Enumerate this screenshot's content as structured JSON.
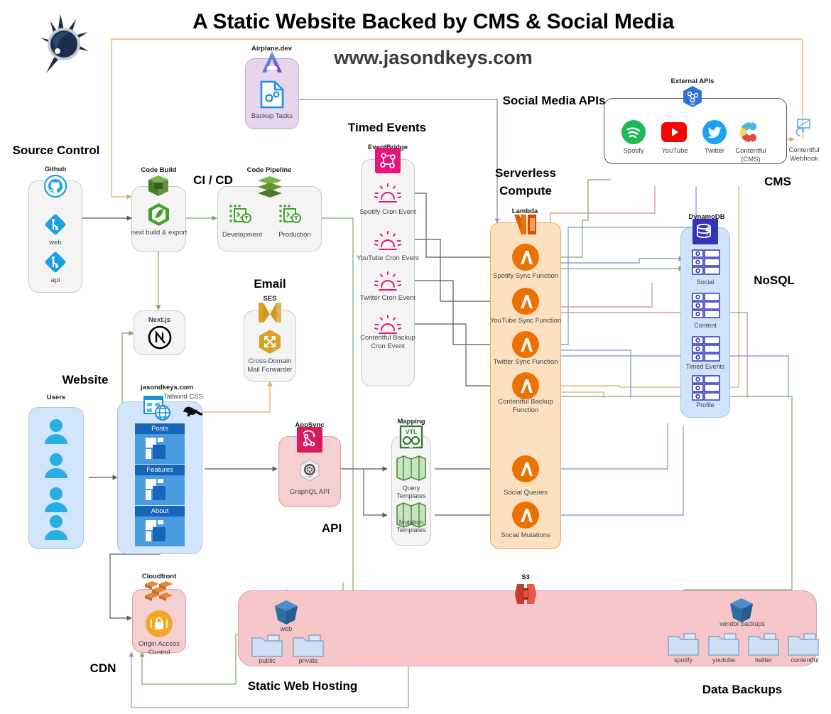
{
  "header": {
    "title": "A Static Website Backed by CMS & Social Media",
    "subtitle": "www.jasondkeys.com",
    "logo_icon": "eyeball-burst-logo"
  },
  "group_headers": {
    "source_control": "Source Control",
    "ci_cd": "CI / CD",
    "email": "Email",
    "timed_events": "Timed Events",
    "social_media_apis": "Social Media APIs",
    "serverless_compute": "Serverless\nCompute",
    "cms": "CMS",
    "nosql": "NoSQL",
    "website": "Website",
    "api": "API",
    "cdn": "CDN",
    "static_web_hosting": "Static Web Hosting",
    "data_backups": "Data Backups"
  },
  "airplane": {
    "service": "Airplane.dev",
    "node": "Backup Tasks",
    "icon": "airplane-dev-icon",
    "node_icon": "tasks-gears-document-icon"
  },
  "source_control": {
    "service": "Github",
    "service_icon": "github-icon",
    "nodes": [
      {
        "label": "web",
        "icon": "git-repo-icon"
      },
      {
        "label": "api",
        "icon": "git-repo-icon"
      }
    ]
  },
  "code_build": {
    "service": "Code Build",
    "service_icon": "aws-codebuild-icon",
    "node": "next build & export",
    "node_icon": "build-hexagon-icon"
  },
  "code_pipeline": {
    "service": "Code Pipeline",
    "service_icon": "aws-codepipeline-icon",
    "nodes": [
      {
        "label": "Development",
        "icon": "pipeline-stage-icon"
      },
      {
        "label": "Production",
        "icon": "pipeline-stage-icon"
      }
    ]
  },
  "nextjs": {
    "label": "Next.js",
    "icon": "nextjs-icon"
  },
  "ses": {
    "service": "SES",
    "service_icon": "aws-ses-icon",
    "node": "Cross-Domain\nMail Forwarder",
    "node_icon": "mail-forwarder-hexagon-icon"
  },
  "eventbridge": {
    "service": "EventBridge",
    "service_icon": "aws-eventbridge-icon",
    "nodes": [
      {
        "label": "Spotify Cron Event",
        "icon": "cron-schedule-icon"
      },
      {
        "label": "YouTube Cron Event",
        "icon": "cron-schedule-icon"
      },
      {
        "label": "Twitter Cron Event",
        "icon": "cron-schedule-icon"
      },
      {
        "label": "Contentful Backup\nCron Event",
        "icon": "cron-schedule-icon"
      }
    ]
  },
  "external_apis": {
    "service": "External APIs",
    "service_icon": "external-apis-icon",
    "nodes": [
      {
        "label": "Spotify",
        "icon": "spotify-icon"
      },
      {
        "label": "YouTube",
        "icon": "youtube-icon"
      },
      {
        "label": "Twitter",
        "icon": "twitter-icon"
      },
      {
        "label": "Contentful\n(CMS)",
        "icon": "contentful-icon"
      }
    ]
  },
  "contentful_webhook": {
    "label": "Contentful\nWebhook",
    "icon": "webhook-hook-icon"
  },
  "lambda": {
    "service": "Lambda",
    "service_icon": "aws-lambda-icon",
    "nodes": [
      {
        "label": "Spotify Sync Function",
        "icon": "lambda-function-icon"
      },
      {
        "label": "YouTube Sync Function",
        "icon": "lambda-function-icon"
      },
      {
        "label": "Twitter Sync Function",
        "icon": "lambda-function-icon"
      },
      {
        "label": "Contentful Backup\nFunction",
        "icon": "lambda-function-icon"
      },
      {
        "label": "Social Queries",
        "icon": "lambda-function-icon"
      },
      {
        "label": "Social Mutations",
        "icon": "lambda-function-icon"
      }
    ]
  },
  "dynamodb": {
    "service": "DynamoDB",
    "service_icon": "aws-dynamodb-icon",
    "tables": [
      {
        "label": "Social",
        "icon": "dynamodb-table-icon"
      },
      {
        "label": "Content",
        "icon": "dynamodb-table-icon"
      },
      {
        "label": "Timed Events",
        "icon": "dynamodb-table-icon"
      },
      {
        "label": "Profile",
        "icon": "dynamodb-table-icon"
      }
    ]
  },
  "users": {
    "service": "Users",
    "count": 4,
    "icon": "user-icon"
  },
  "site": {
    "service": "jasondkeys.com",
    "service_icon": "website-globe-icon",
    "framework_label": "Tailwind CSS",
    "framework_icon": "tailwind-css-icon",
    "pages": [
      {
        "label": "Posts",
        "icon": "page-layout-icon"
      },
      {
        "label": "Features",
        "icon": "page-layout-icon"
      },
      {
        "label": "About",
        "icon": "page-layout-icon"
      }
    ]
  },
  "appsync": {
    "service": "AppSync",
    "service_icon": "aws-appsync-icon",
    "node": "GraphQL API",
    "node_icon": "graphql-api-icon"
  },
  "mapping": {
    "service": "Mapping",
    "service_icon": "vtl-icon",
    "nodes": [
      {
        "label": "Query\nTemplates",
        "icon": "mapping-template-icon"
      },
      {
        "label": "Mutation\nTemplates",
        "icon": "mapping-template-icon"
      }
    ]
  },
  "cloudfront": {
    "service": "Cloudfront",
    "service_icon": "aws-cloudfront-icon",
    "node": "Origin Access\nControl",
    "node_icon": "origin-access-control-icon"
  },
  "s3_web": {
    "bucket": "web",
    "bucket_icon": "s3-bucket-icon",
    "folders": [
      {
        "label": "public",
        "icon": "folder-icon"
      },
      {
        "label": "private",
        "icon": "folder-icon"
      }
    ]
  },
  "s3_backups": {
    "service": "S3",
    "service_icon": "aws-s3-icon",
    "bucket": "vendor backups",
    "bucket_icon": "s3-bucket-icon",
    "folders": [
      {
        "label": "spotify",
        "icon": "folder-icon"
      },
      {
        "label": "youtube",
        "icon": "folder-icon"
      },
      {
        "label": "twitter",
        "icon": "folder-icon"
      },
      {
        "label": "contentful",
        "icon": "folder-icon"
      }
    ]
  },
  "colors": {
    "lambda_orange": "#ED7100",
    "dynamo_blue": "#3334B9",
    "eventbridge_pink": "#E7157B",
    "appsync_pink": "#D81B60",
    "spotify_green": "#1DB954",
    "youtube_red": "#FF0000",
    "twitter_blue": "#1DA1F2",
    "contentful_yellow": "#FFD85F",
    "s3_red": "#E25444",
    "codebuild_green": "#6CAE3E",
    "ses_gold": "#C7981E",
    "github_blue": "#1CA0E3"
  }
}
